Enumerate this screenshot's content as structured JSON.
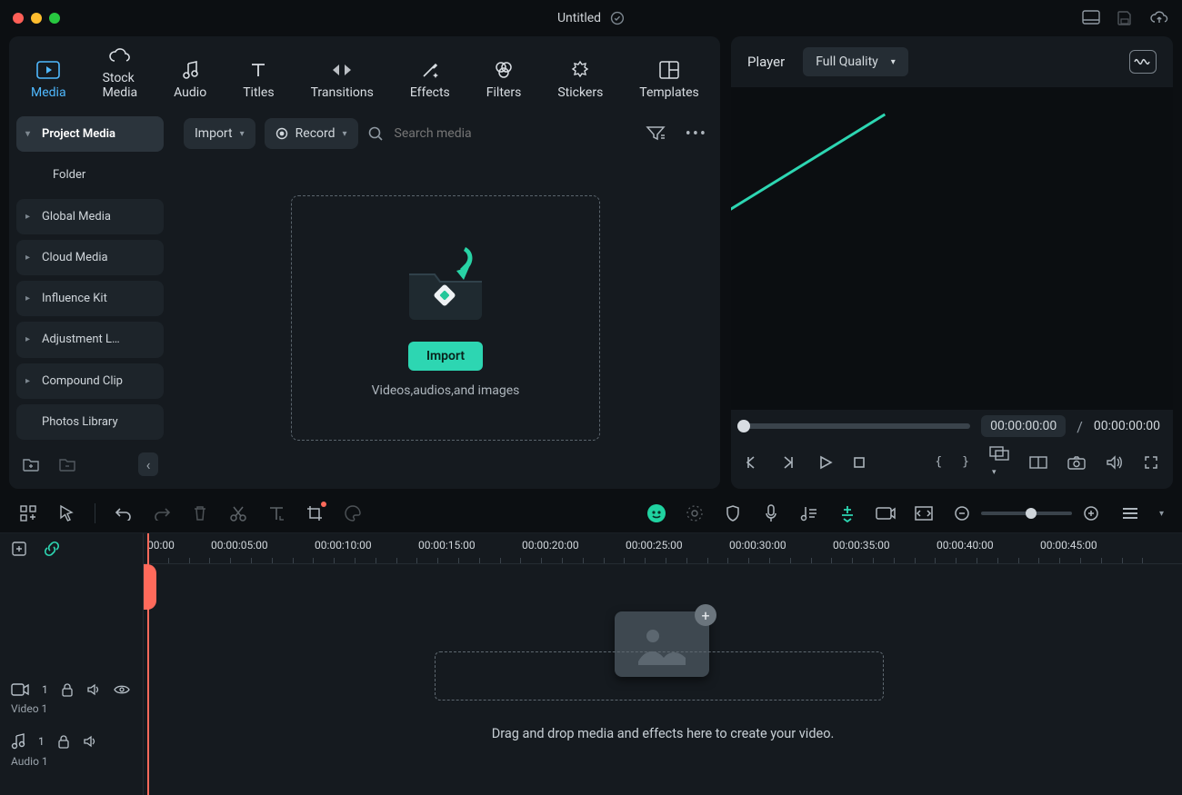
{
  "title": "Untitled",
  "tabs": [
    {
      "label": "Media",
      "active": true
    },
    {
      "label": "Stock Media"
    },
    {
      "label": "Audio"
    },
    {
      "label": "Titles"
    },
    {
      "label": "Transitions"
    },
    {
      "label": "Effects"
    },
    {
      "label": "Filters"
    },
    {
      "label": "Stickers"
    },
    {
      "label": "Templates"
    }
  ],
  "sidebar": {
    "items": [
      {
        "label": "Project Media",
        "expander": "down",
        "active": true
      },
      {
        "label": "Folder",
        "plain": true
      },
      {
        "label": "Global Media",
        "expander": "right"
      },
      {
        "label": "Cloud Media",
        "expander": "right"
      },
      {
        "label": "Influence Kit",
        "expander": "right"
      },
      {
        "label": "Adjustment L…",
        "expander": "right"
      },
      {
        "label": "Compound Clip",
        "expander": "right"
      },
      {
        "label": "Photos Library",
        "plain_bg": true
      }
    ]
  },
  "content_toolbar": {
    "import": "Import",
    "record": "Record",
    "search_placeholder": "Search media"
  },
  "dropzone": {
    "button": "Import",
    "subtitle": "Videos,audios,and images"
  },
  "player": {
    "label": "Player",
    "quality": "Full Quality",
    "current": "00:00:00:00",
    "total": "00:00:00:00"
  },
  "ruler": {
    "marks": [
      "00:00",
      "00:00:05:00",
      "00:00:10:00",
      "00:00:15:00",
      "00:00:20:00",
      "00:00:25:00",
      "00:00:30:00",
      "00:00:35:00",
      "00:00:40:00",
      "00:00:45:00"
    ]
  },
  "tracks": {
    "video": {
      "badge": "1",
      "name": "Video 1"
    },
    "audio": {
      "badge": "1",
      "name": "Audio 1"
    }
  },
  "timeline_hint": "Drag and drop media and effects here to create your video.",
  "colors": {
    "accent": "#2dd6b2"
  }
}
